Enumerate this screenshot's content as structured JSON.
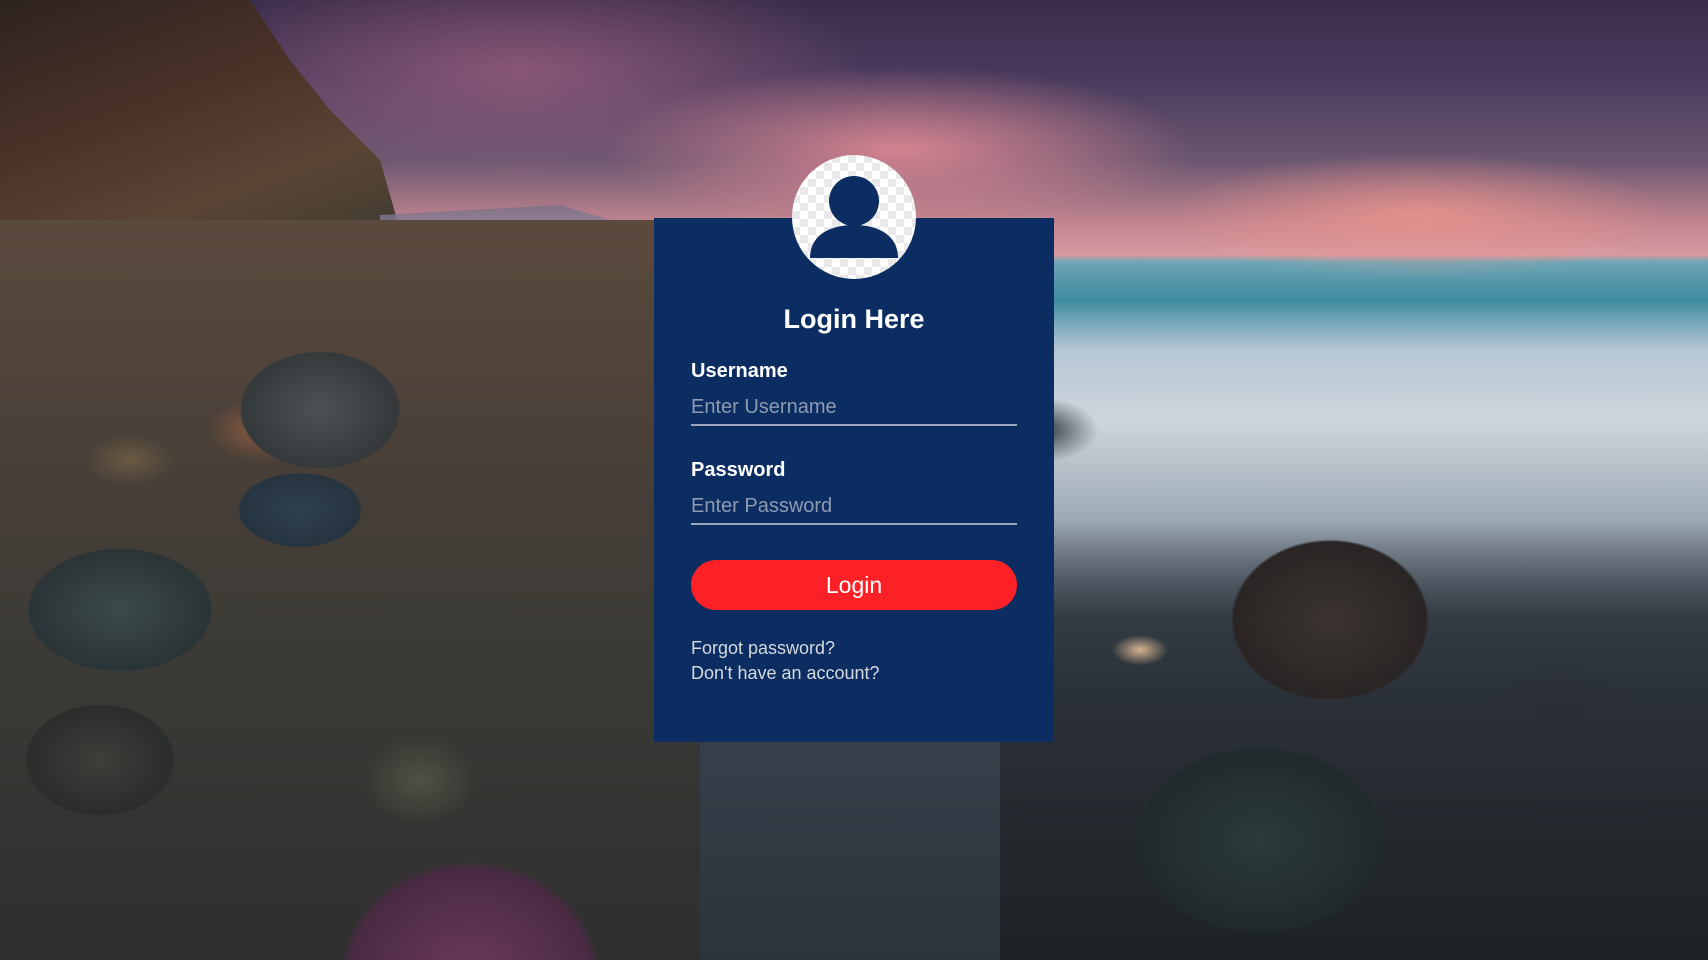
{
  "login": {
    "title": "Login Here",
    "username_label": "Username",
    "username_placeholder": "Enter Username",
    "password_label": "Password",
    "password_placeholder": "Enter Password",
    "submit_label": "Login",
    "forgot_password": "Forgot password?",
    "signup_link": "Don't have an account?"
  },
  "avatar": {
    "icon": "user-icon"
  },
  "colors": {
    "card_background": "#0c2d61",
    "button": "#fc2127",
    "text": "#ffffff"
  },
  "background": {
    "scene": "rocky-beach-sunset"
  }
}
